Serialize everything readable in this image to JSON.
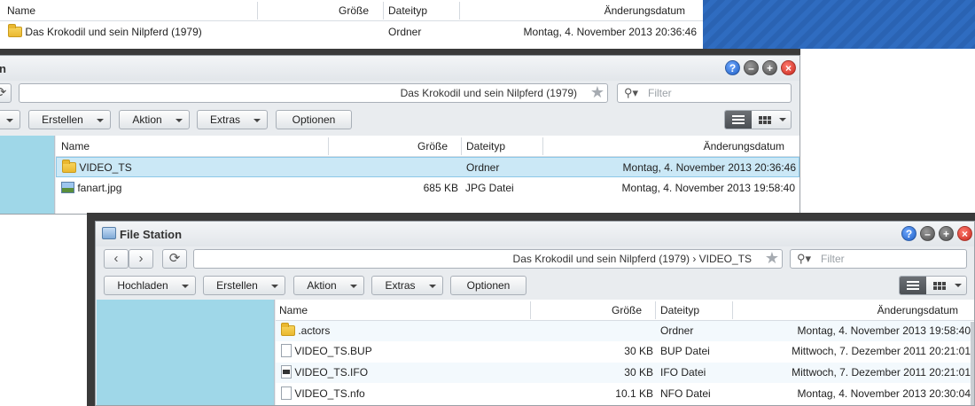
{
  "columns": {
    "name": "Name",
    "size": "Größe",
    "type": "Dateityp",
    "date": "Änderungsdatum"
  },
  "top_listing": {
    "rows": [
      {
        "name": "Das Krokodil und sein Nilpferd (1979)",
        "size": "",
        "type": "Ordner",
        "date": "Montag, 4. November 2013 20:36:46",
        "icon": "folder-icon"
      }
    ]
  },
  "window_middle": {
    "title_partial": "n",
    "path": "Das Krokodil und sein Nilpferd (1979)",
    "filter_placeholder": "Filter",
    "toolbar": {
      "create": "Erstellen",
      "action": "Aktion",
      "extras": "Extras",
      "options": "Optionen"
    },
    "rows": [
      {
        "name": "VIDEO_TS",
        "size": "",
        "type": "Ordner",
        "date": "Montag, 4. November 2013 20:36:46",
        "icon": "folder-icon",
        "selected": true
      },
      {
        "name": "fanart.jpg",
        "size": "685 KB",
        "type": "JPG Datei",
        "date": "Montag, 4. November 2013 19:58:40",
        "icon": "image-file-icon"
      }
    ]
  },
  "window_front": {
    "title": "File Station",
    "path": "Das Krokodil und sein Nilpferd (1979)  › VIDEO_TS",
    "filter_placeholder": "Filter",
    "toolbar": {
      "upload": "Hochladen",
      "create": "Erstellen",
      "action": "Aktion",
      "extras": "Extras",
      "options": "Optionen"
    },
    "rows": [
      {
        "name": ".actors",
        "size": "",
        "type": "Ordner",
        "date": "Montag, 4. November 2013 19:58:40",
        "icon": "folder-icon"
      },
      {
        "name": "VIDEO_TS.BUP",
        "size": "30 KB",
        "type": "BUP Datei",
        "date": "Mittwoch, 7. Dezember 2011 20:21:01",
        "icon": "file-icon"
      },
      {
        "name": "VIDEO_TS.IFO",
        "size": "30 KB",
        "type": "IFO Datei",
        "date": "Mittwoch, 7. Dezember 2011 20:21:01",
        "icon": "video-file-icon"
      },
      {
        "name": "VIDEO_TS.nfo",
        "size": "10.1 KB",
        "type": "NFO Datei",
        "date": "Montag, 4. November 2013 20:30:04",
        "icon": "file-icon"
      }
    ]
  },
  "window_controls": {
    "help": "?",
    "minimize": "–",
    "maximize": "+",
    "close": "×"
  },
  "colors": {
    "sidebar": "#9fd7e8",
    "selection": "#cbe8f6",
    "desktop": "#2a63b3"
  }
}
